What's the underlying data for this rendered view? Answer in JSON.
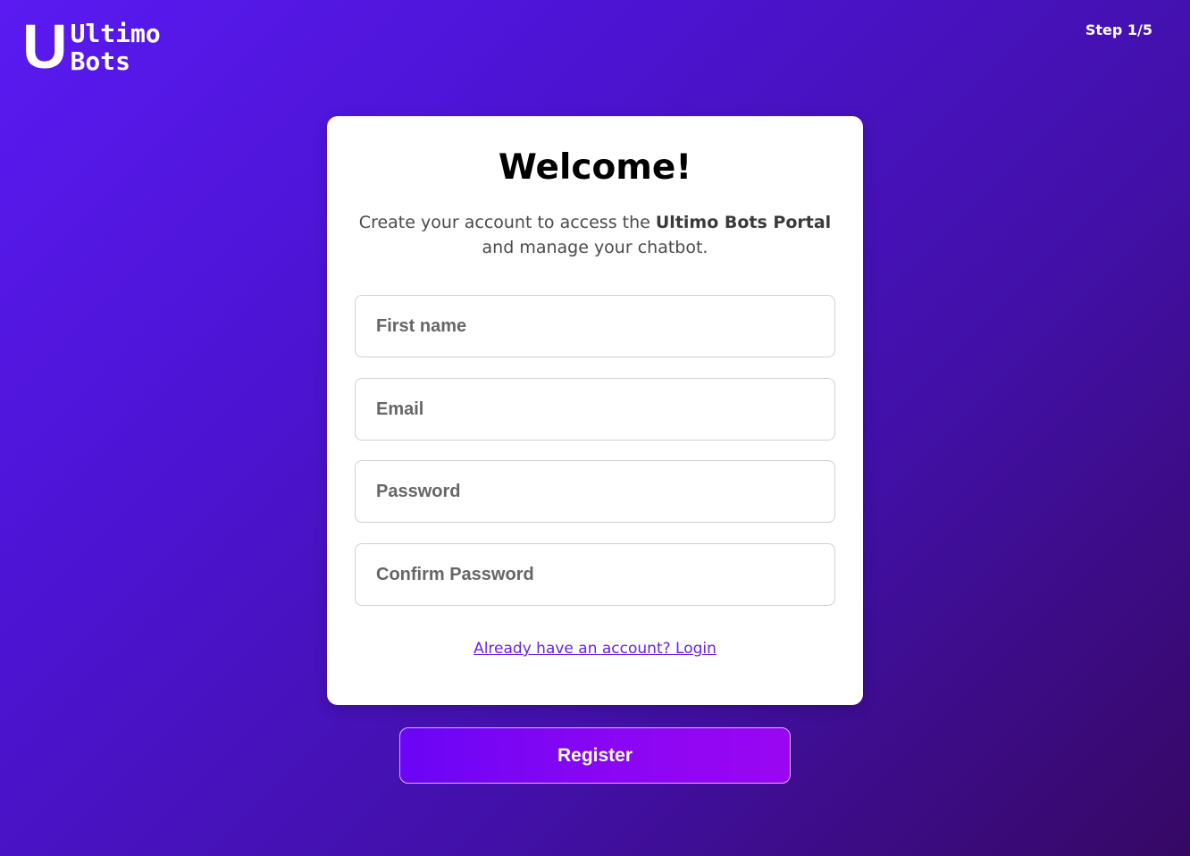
{
  "brand": {
    "mark": "U",
    "line1": "Ultimo",
    "line2": "Bots"
  },
  "step": "Step 1/5",
  "card": {
    "title": "Welcome!",
    "subtitle_pre": "Create your account to access the ",
    "subtitle_bold": "Ultimo Bots Portal",
    "subtitle_post": " and manage your chatbot."
  },
  "form": {
    "first_name_placeholder": "First name",
    "email_placeholder": "Email",
    "password_placeholder": "Password",
    "confirm_password_placeholder": "Confirm Password"
  },
  "login_link": "Already have an account? Login",
  "register_label": "Register",
  "colors": {
    "accent": "#7a06f5",
    "link": "#6a22e6",
    "background_start": "#5a1af2",
    "background_end": "#360864"
  }
}
